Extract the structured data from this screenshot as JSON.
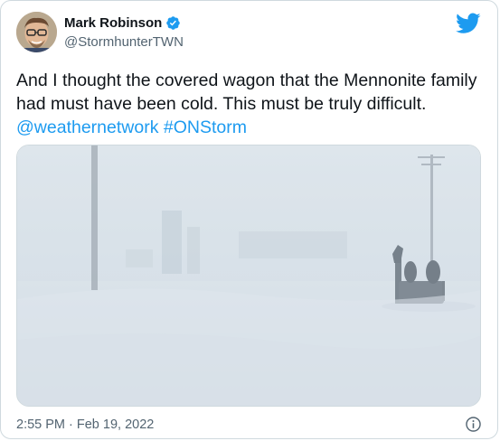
{
  "author": {
    "display_name": "Mark Robinson",
    "handle": "@StormhunterTWN"
  },
  "tweet": {
    "text": "And I thought the covered wagon that the Mennonite family had must have been cold. This must be truly difficult.",
    "mention": "@weathernetwork",
    "hashtag": "#ONStorm",
    "timestamp": "2:55 PM · Feb 19, 2022"
  },
  "icons": {
    "verified": "verified-badge-icon",
    "brand": "twitter-bird-icon",
    "info": "info-icon"
  },
  "colors": {
    "link": "#1d9bf0",
    "secondary_text": "#536471",
    "primary_text": "#0f1419"
  }
}
